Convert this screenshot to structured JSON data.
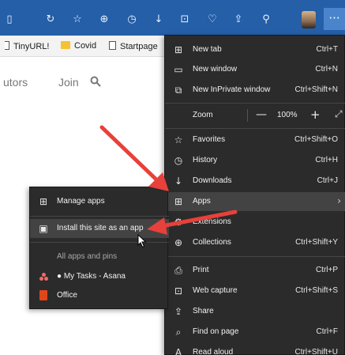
{
  "toolbar": {
    "icons": [
      "tab-actions-icon",
      "refresh-icon",
      "add-favorite-icon",
      "collections-icon",
      "history-icon",
      "downloads-icon",
      "web-capture-icon",
      "browser-essentials-icon",
      "share-icon",
      "extensions-icon",
      "profile-avatar",
      "settings-more-icon"
    ],
    "more_label": "···"
  },
  "favorites_bar": {
    "items": [
      {
        "label": "TinyURL!"
      },
      {
        "label": "Covid"
      },
      {
        "label": "Startpage"
      }
    ]
  },
  "page": {
    "nav_partial": "utors",
    "join": "Join"
  },
  "menu": {
    "items": [
      {
        "label": "New tab",
        "shortcut": "Ctrl+T",
        "icon": "new-tab-icon"
      },
      {
        "label": "New window",
        "shortcut": "Ctrl+N",
        "icon": "new-window-icon"
      },
      {
        "label": "New InPrivate window",
        "shortcut": "Ctrl+Shift+N",
        "icon": "inprivate-icon"
      },
      {
        "label": "Zoom",
        "zoom_value": "100%",
        "icon": ""
      },
      {
        "label": "Favorites",
        "shortcut": "Ctrl+Shift+O",
        "icon": "favorites-icon"
      },
      {
        "label": "History",
        "shortcut": "Ctrl+H",
        "icon": "history-icon"
      },
      {
        "label": "Downloads",
        "shortcut": "Ctrl+J",
        "icon": "download-icon"
      },
      {
        "label": "Apps",
        "shortcut": "",
        "icon": "apps-icon"
      },
      {
        "label": "Extensions",
        "shortcut": "",
        "icon": "extensions-icon"
      },
      {
        "label": "Collections",
        "shortcut": "Ctrl+Shift+Y",
        "icon": "collections-icon"
      },
      {
        "label": "Print",
        "shortcut": "Ctrl+P",
        "icon": "print-icon"
      },
      {
        "label": "Web capture",
        "shortcut": "Ctrl+Shift+S",
        "icon": "web-capture-icon"
      },
      {
        "label": "Share",
        "shortcut": "",
        "icon": "share-icon"
      },
      {
        "label": "Find on page",
        "shortcut": "Ctrl+F",
        "icon": "find-icon"
      },
      {
        "label": "Read aloud",
        "shortcut": "Ctrl+Shift+U",
        "icon": "read-aloud-icon"
      }
    ]
  },
  "submenu": {
    "manage_apps": "Manage apps",
    "install_site": "Install this site as an app",
    "all_apps_header": "All apps and pins",
    "apps": [
      {
        "label": "● My Tasks - Asana"
      },
      {
        "label": "Office"
      }
    ]
  },
  "colors": {
    "toolbar": "#245fa8",
    "menu_bg": "#2b2b2b",
    "menu_highlight": "#434343",
    "annotation_arrow": "#e8403a"
  }
}
